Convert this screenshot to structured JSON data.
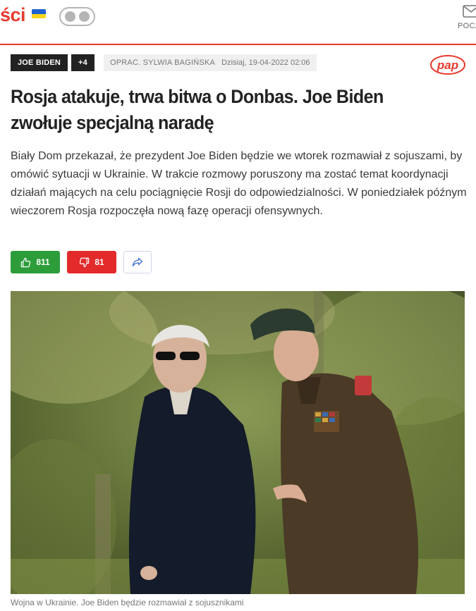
{
  "header": {
    "brand_fragment": "ści",
    "mail_label": "POCZ"
  },
  "article": {
    "tag_main": "JOE BIDEN",
    "tag_more": "+4",
    "author": "OPRAC. SYLWIA BAGIŃSKA",
    "date": "Dzisiaj, 19-04-2022 02:06",
    "source_logo": "pap",
    "title": "Rosja atakuje, trwa bitwa o Donbas. Joe Biden zwołuje specjalną naradę",
    "lead": "Biały Dom przekazał, że prezydent Joe Biden będzie we wtorek rozmawiał z sojuszami, by omówić sytuacji w Ukrainie. W trakcie rozmowy poruszony ma zostać temat koordynacji działań mających na celu pociągnięcie Rosji do odpowiedzialności. W poniedziałek późnym wieczorem Rosja rozpoczęła nową fazę operacji ofensywnych.",
    "likes": "811",
    "dislikes": "81",
    "caption": "Wojna w Ukrainie. Joe Biden będzie rozmawiał z sojusznikami"
  },
  "colors": {
    "brand": "#e53a2e",
    "like": "#2d9d3a",
    "dislike": "#e32b2b",
    "tag_bg": "#222222"
  },
  "icons": {
    "flag": "ukraine-flag-icon",
    "toggle": "theme-toggle-icon",
    "mail": "mail-icon",
    "like": "thumbs-up-icon",
    "dislike": "thumbs-down-icon",
    "share": "share-arrow-icon"
  }
}
